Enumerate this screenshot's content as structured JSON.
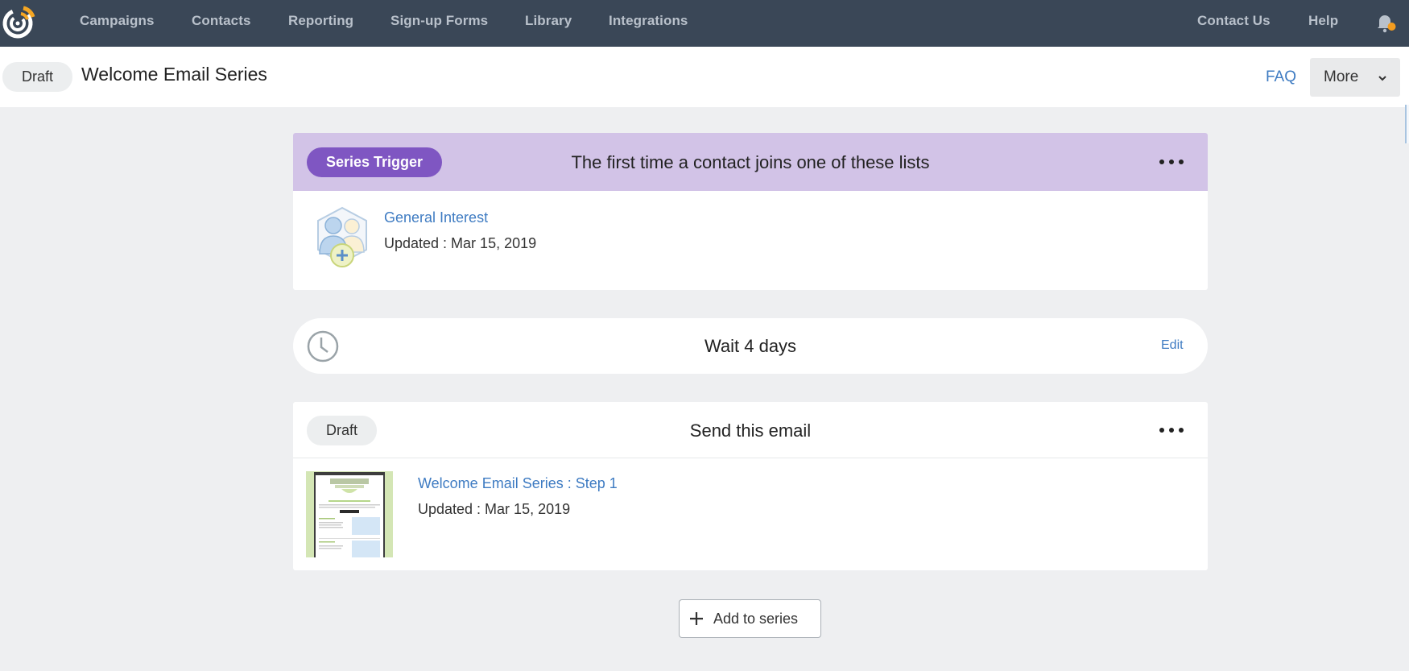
{
  "topnav": {
    "logo": "constant-contact-logo-icon",
    "items": [
      {
        "label": "Campaigns"
      },
      {
        "label": "Contacts"
      },
      {
        "label": "Reporting"
      },
      {
        "label": "Sign-up Forms"
      },
      {
        "label": "Library"
      },
      {
        "label": "Integrations"
      }
    ],
    "right_items": [
      {
        "label": "Contact Us"
      },
      {
        "label": "Help"
      }
    ],
    "notification_icon": "bell-icon",
    "notification_dot_color": "#f39c1f"
  },
  "header": {
    "status": "Draft",
    "title": "Welcome Email Series",
    "faq_label": "FAQ",
    "more_label": "More"
  },
  "trigger": {
    "badge": "Series Trigger",
    "title": "The first time a contact joins one of these lists",
    "list_name": "General Interest",
    "updated": "Updated : Mar 15, 2019"
  },
  "wait": {
    "label": "Wait 4 days",
    "edit_label": "Edit"
  },
  "send": {
    "status": "Draft",
    "title": "Send this email",
    "email_name": "Welcome Email Series : Step 1",
    "updated": "Updated : Mar 15, 2019"
  },
  "add_button": {
    "label": "Add to series"
  },
  "colors": {
    "topbar": "#3a4757",
    "trigger_header": "#d2c3e7",
    "trigger_badge": "#7f56c2",
    "link": "#3e7bc2",
    "background": "#eeeff1"
  }
}
